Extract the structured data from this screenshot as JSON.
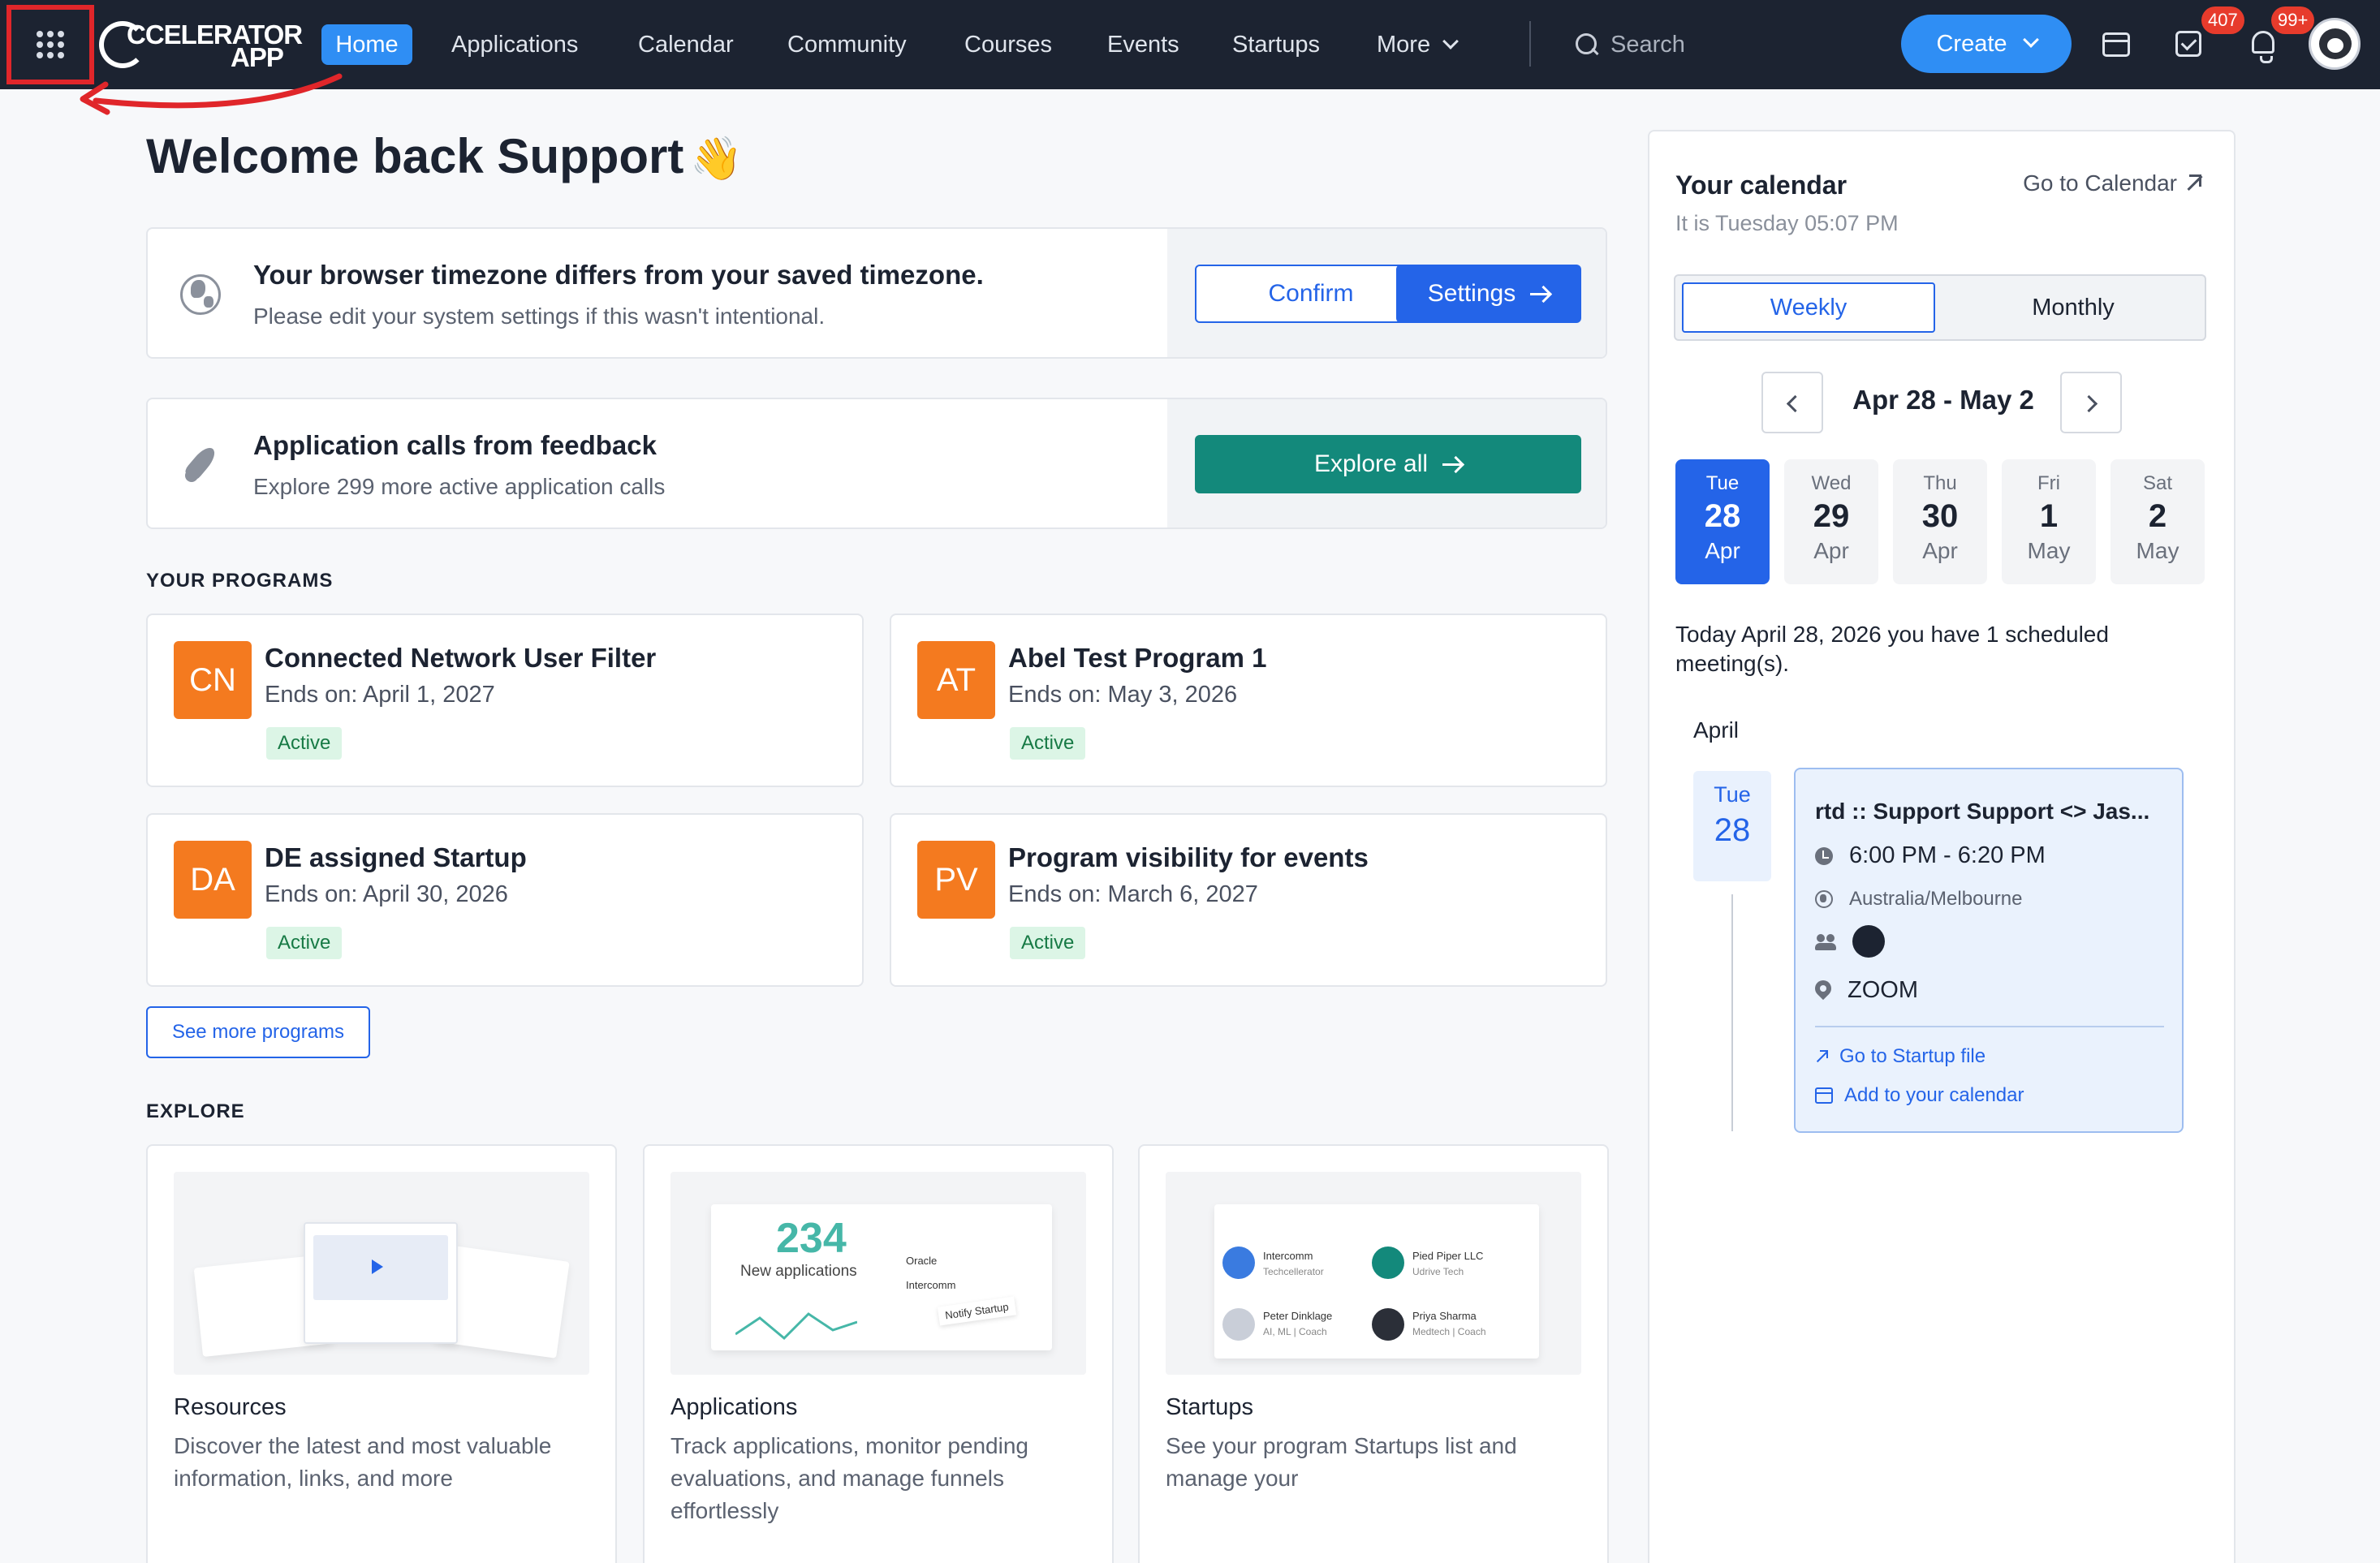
{
  "nav": {
    "logo_line1": "CCELERATOR",
    "logo_line2": "APP",
    "links": [
      "Home",
      "Applications",
      "Calendar",
      "Community",
      "Courses",
      "Events",
      "Startups",
      "More"
    ],
    "search_placeholder": "Search",
    "create_label": "Create",
    "tasks_badge": "407",
    "notifications_badge": "99+"
  },
  "welcome": {
    "title": "Welcome back Support",
    "emoji": "👋"
  },
  "timezone_banner": {
    "title": "Your browser timezone differs from your saved timezone.",
    "subtitle": "Please edit your system settings if this wasn't intentional.",
    "confirm_label": "Confirm",
    "settings_label": "Settings"
  },
  "calls_banner": {
    "title": "Application calls from feedback",
    "subtitle": "Explore 299 more active application calls",
    "explore_label": "Explore all"
  },
  "programs": {
    "section_label": "YOUR PROGRAMS",
    "items": [
      {
        "initials": "CN",
        "title": "Connected Network User Filter",
        "ends": "Ends on: April 1, 2027",
        "status": "Active"
      },
      {
        "initials": "AT",
        "title": "Abel Test Program 1",
        "ends": "Ends on: May 3, 2026",
        "status": "Active"
      },
      {
        "initials": "DA",
        "title": "DE assigned Startup",
        "ends": "Ends on: April 30, 2026",
        "status": "Active"
      },
      {
        "initials": "PV",
        "title": "Program visibility for events",
        "ends": "Ends on: March 6, 2027",
        "status": "Active"
      }
    ],
    "see_more_label": "See more programs"
  },
  "explore": {
    "section_label": "EXPLORE",
    "cards": [
      {
        "title": "Resources",
        "description": "Discover the latest and most valuable information, links, and more"
      },
      {
        "title": "Applications",
        "description": "Track applications, monitor pending evaluations, and manage funnels effortlessly"
      },
      {
        "title": "Startups",
        "description": "See your program Startups list and manage your"
      }
    ],
    "applications_illustration": {
      "count": "234",
      "caption": "New applications",
      "mini_items": [
        "Oracle",
        "Intercomm",
        "Notify Startup"
      ]
    },
    "startups_illustration": {
      "people": [
        {
          "name": "Intercomm",
          "sub": "Techcellerator"
        },
        {
          "name": "Pied Piper LLC",
          "sub": "Udrive Tech"
        },
        {
          "name": "Peter Dinklage",
          "sub": "AI, ML | Coach"
        },
        {
          "name": "Priya Sharma",
          "sub": "Medtech | Coach"
        }
      ]
    }
  },
  "calendar": {
    "title": "Your calendar",
    "subtitle": "It is Tuesday 05:07 PM",
    "go_label": "Go to Calendar",
    "tabs": [
      "Weekly",
      "Monthly"
    ],
    "range": "Apr 28 - May 2",
    "days": [
      {
        "weekday": "Tue",
        "num": "28",
        "month": "Apr"
      },
      {
        "weekday": "Wed",
        "num": "29",
        "month": "Apr"
      },
      {
        "weekday": "Thu",
        "num": "30",
        "month": "Apr"
      },
      {
        "weekday": "Fri",
        "num": "1",
        "month": "May"
      },
      {
        "weekday": "Sat",
        "num": "2",
        "month": "May"
      }
    ],
    "today_text": "Today April 28, 2026 you have 1 scheduled meeting(s).",
    "month_label": "April",
    "event": {
      "weekday": "Tue",
      "day": "28",
      "title": "rtd :: Support Support <> Jas...",
      "time": "6:00 PM - 6:20 PM",
      "timezone": "Australia/Melbourne",
      "location": "ZOOM",
      "startup_link": "Go to Startup file",
      "calendar_link": "Add to your calendar"
    }
  },
  "colors": {
    "nav_bg": "#1c2331",
    "primary": "#2464e8",
    "teal": "#13897b",
    "avatar_orange": "#f47a1f",
    "active_badge_bg": "#dcf5e6",
    "annotation_red": "#e0262a"
  }
}
